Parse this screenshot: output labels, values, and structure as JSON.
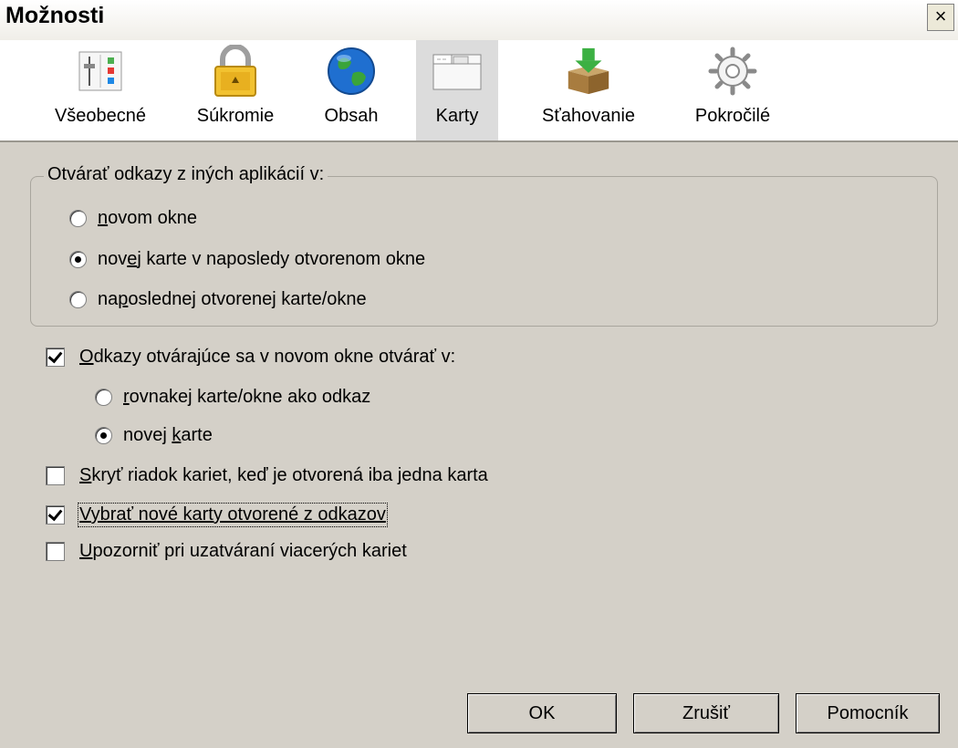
{
  "window": {
    "title": "Možnosti",
    "close_glyph": "×"
  },
  "toolbar": {
    "items": [
      {
        "label": "Všeobecné",
        "icon": "general-settings-icon"
      },
      {
        "label": "Súkromie",
        "icon": "padlock-icon"
      },
      {
        "label": "Obsah",
        "icon": "globe-icon"
      },
      {
        "label": "Karty",
        "icon": "tabs-icon",
        "selected": true
      },
      {
        "label": "Sťahovanie",
        "icon": "download-box-icon"
      },
      {
        "label": "Pokročilé",
        "icon": "gear-icon"
      }
    ]
  },
  "open_links": {
    "group_label": "Otvárať odkazy z iných aplikácií v:",
    "options": [
      {
        "prefix": "",
        "accel": "n",
        "rest": "ovom okne",
        "selected": false
      },
      {
        "prefix": "nov",
        "accel": "e",
        "rest": "j karte v naposledy otvorenom okne",
        "selected": true
      },
      {
        "prefix": "na",
        "accel": "p",
        "rest": "oslednej otvorenej karte/okne",
        "selected": false
      }
    ]
  },
  "new_window_links": {
    "checked": true,
    "accel": "O",
    "rest": "dkazy otvárajúce sa v novom okne otvárať v:",
    "options": [
      {
        "prefix": "",
        "accel": "r",
        "rest": "ovnakej karte/okne ako odkaz",
        "selected": false
      },
      {
        "prefix": "novej ",
        "accel": "k",
        "rest": "arte",
        "selected": true
      }
    ]
  },
  "checkboxes": [
    {
      "accel": "S",
      "rest": "kryť riadok kariet, keď je otvorená iba jedna karta",
      "checked": false
    },
    {
      "accel": "V",
      "rest": "ybrať nové karty otvorené z odkazov",
      "checked": true,
      "focused": true
    },
    {
      "accel": "U",
      "rest": "pozorniť pri uzatváraní viacerých kariet",
      "checked": false
    }
  ],
  "buttons": {
    "ok": "OK",
    "cancel": "Zrušiť",
    "help": "Pomocník"
  }
}
